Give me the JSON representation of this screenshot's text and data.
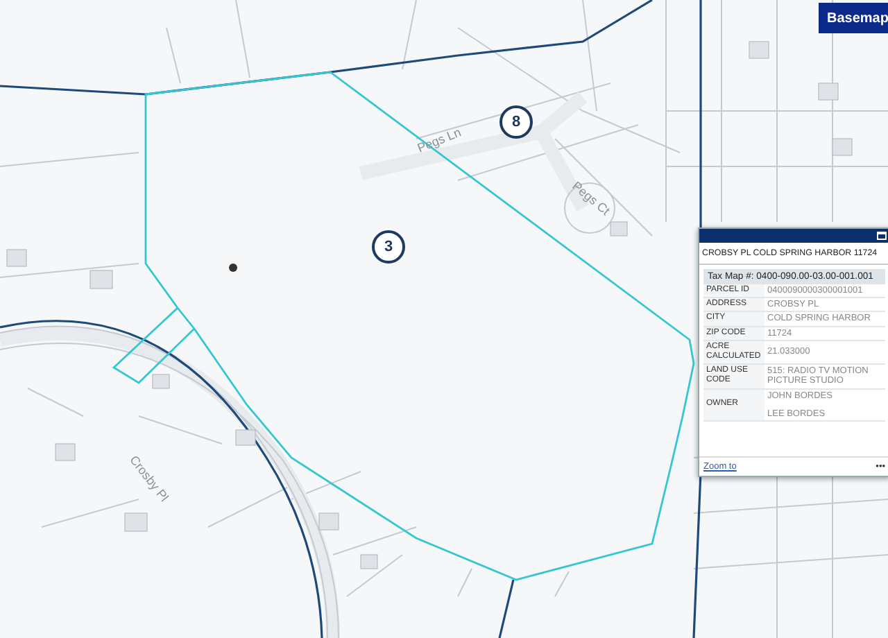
{
  "map": {
    "parcel_markers": [
      {
        "label": "3"
      },
      {
        "label": "8"
      }
    ],
    "road_labels": [
      {
        "label": "Crosby Pl"
      },
      {
        "label": "Pegs Ln"
      },
      {
        "label": "Pegs Ct"
      }
    ]
  },
  "basemap_button": {
    "label": "Basemap"
  },
  "popup": {
    "title": "CROBSY PL COLD SPRING HARBOR 11724",
    "tax_map": "Tax Map #: 0400-090.00-03.00-001.001",
    "rows": [
      {
        "label": "PARCEL ID",
        "values": [
          "0400090000300001001"
        ]
      },
      {
        "label": "ADDRESS",
        "values": [
          "CROBSY PL"
        ]
      },
      {
        "label": "CITY",
        "values": [
          "COLD SPRING HARBOR"
        ]
      },
      {
        "label": "ZIP CODE",
        "values": [
          "11724"
        ]
      },
      {
        "label": "ACRE CALCULATED",
        "values": [
          "21.033000"
        ]
      },
      {
        "label": "LAND USE CODE",
        "values": [
          "515: RADIO TV MOTION PICTURE STUDIO"
        ]
      },
      {
        "label": "OWNER",
        "values": [
          "JOHN BORDES",
          "LEE BORDES"
        ]
      }
    ],
    "zoom_link": "Zoom to",
    "more": "•••"
  }
}
